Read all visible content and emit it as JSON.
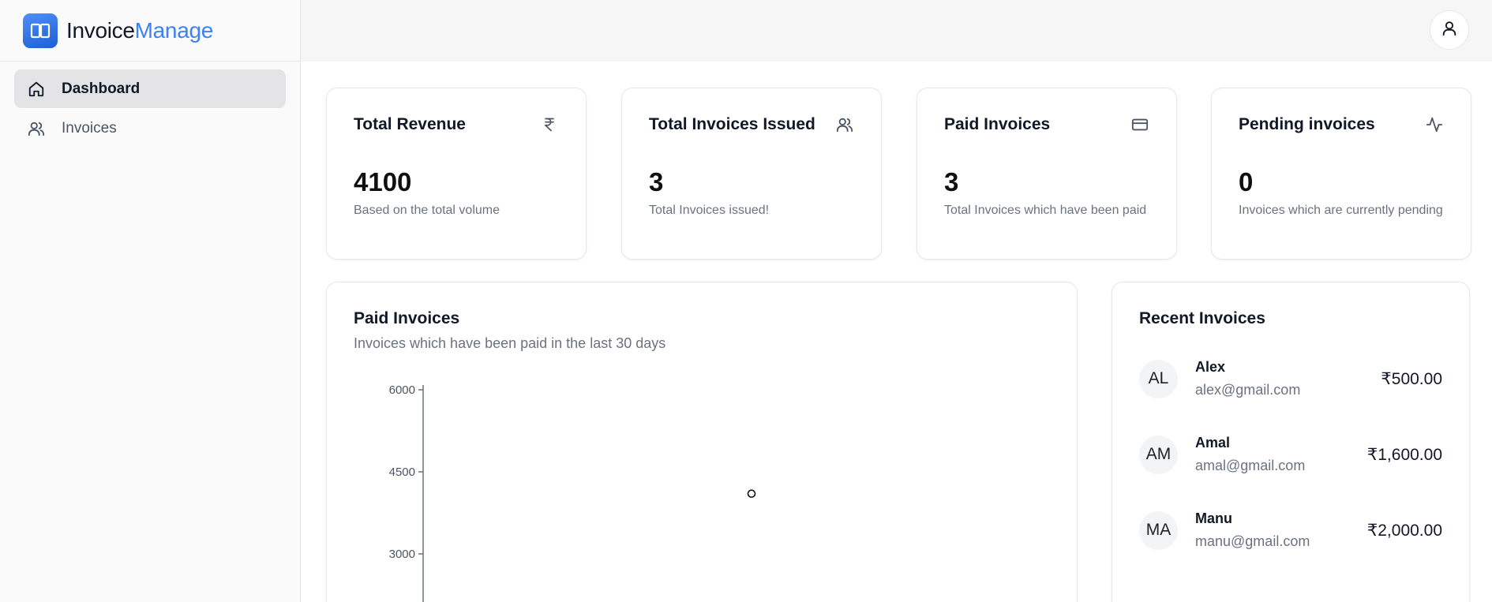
{
  "brand": {
    "name_part1": "Invoice",
    "name_part2": "Manage",
    "accent_color": "#3b82f6",
    "logo_icon": "book-open-icon"
  },
  "sidebar": {
    "items": [
      {
        "label": "Dashboard",
        "icon": "home-icon",
        "active": true
      },
      {
        "label": "Invoices",
        "icon": "users-icon",
        "active": false
      }
    ]
  },
  "header": {
    "user_icon": "user-icon"
  },
  "stats": [
    {
      "title": "Total Revenue",
      "icon": "rupee-icon",
      "value": "4100",
      "description": "Based on the total volume"
    },
    {
      "title": "Total Invoices Issued",
      "icon": "users-icon",
      "value": "3",
      "description": "Total Invoices issued!"
    },
    {
      "title": "Paid Invoices",
      "icon": "credit-card-icon",
      "value": "3",
      "description": "Total Invoices which have been paid"
    },
    {
      "title": "Pending invoices",
      "icon": "activity-icon",
      "value": "0",
      "description": "Invoices which are currently pending"
    }
  ],
  "chart_card": {
    "title": "Paid Invoices",
    "subtitle": "Invoices which have been paid in the last 30 days"
  },
  "chart_data": {
    "type": "line",
    "title": "",
    "xlabel": "",
    "ylabel": "",
    "y_ticks": [
      6000,
      4500,
      3000
    ],
    "ylim": [
      1500,
      6000
    ],
    "series": [
      {
        "values": [
          4100
        ]
      }
    ],
    "grid": false
  },
  "recent": {
    "title": "Recent Invoices",
    "items": [
      {
        "initials": "AL",
        "name": "Alex",
        "email": "alex@gmail.com",
        "amount": "₹500.00"
      },
      {
        "initials": "AM",
        "name": "Amal",
        "email": "amal@gmail.com",
        "amount": "₹1,600.00"
      },
      {
        "initials": "MA",
        "name": "Manu",
        "email": "manu@gmail.com",
        "amount": "₹2,000.00"
      }
    ]
  }
}
